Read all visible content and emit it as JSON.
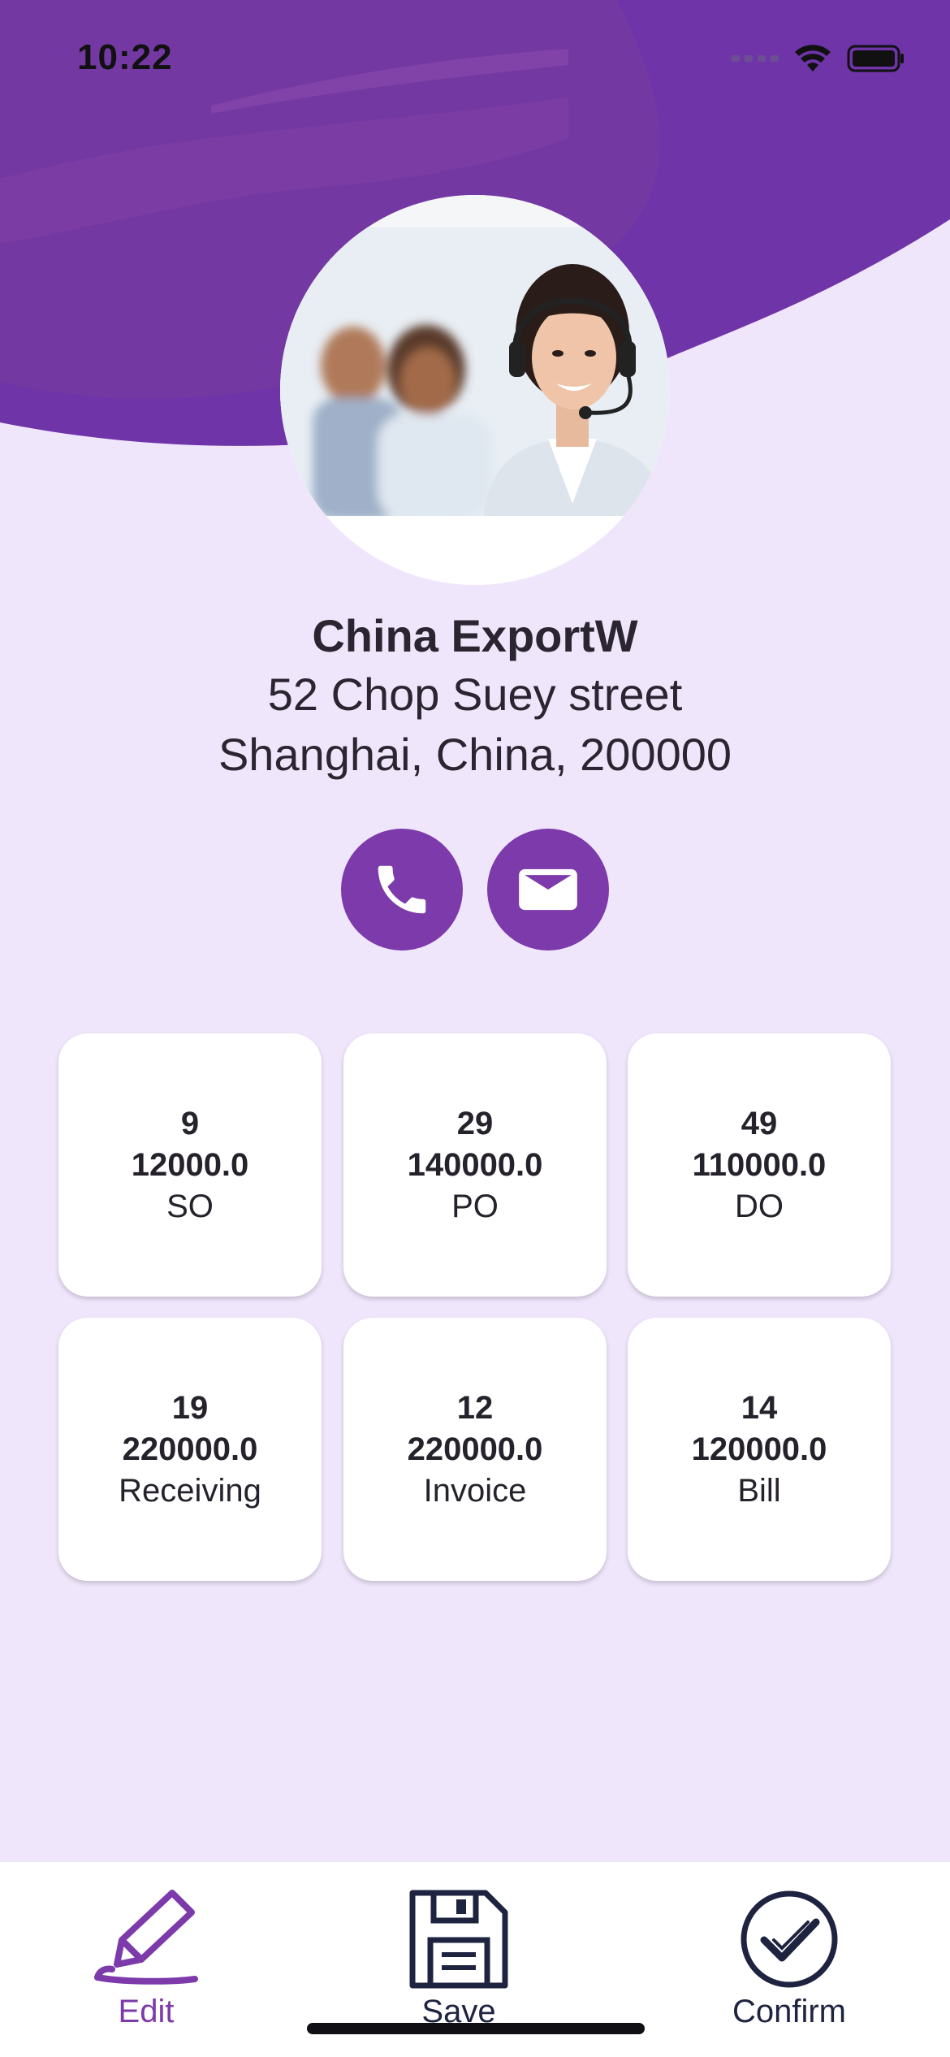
{
  "status_bar": {
    "time": "10:22"
  },
  "profile": {
    "name": "China ExportW",
    "address_line1": "52 Chop Suey street",
    "address_line2": "Shanghai, China, 200000"
  },
  "colors": {
    "accent": "#7C3AAA",
    "header": "#6E34A8",
    "background": "#F0E6FC",
    "card": "#FFFFFF"
  },
  "contact": {
    "phone_icon": "phone-icon",
    "mail_icon": "mail-icon"
  },
  "stats": [
    {
      "count": "9",
      "amount": "12000.0",
      "label": "SO"
    },
    {
      "count": "29",
      "amount": "140000.0",
      "label": "PO"
    },
    {
      "count": "49",
      "amount": "110000.0",
      "label": "DO"
    },
    {
      "count": "19",
      "amount": "220000.0",
      "label": "Receiving"
    },
    {
      "count": "12",
      "amount": "220000.0",
      "label": "Invoice"
    },
    {
      "count": "14",
      "amount": "120000.0",
      "label": "Bill"
    }
  ],
  "bottom_nav": {
    "edit": {
      "label": "Edit",
      "icon": "pencil-icon",
      "color": "#7C3AAA"
    },
    "save": {
      "label": "Save",
      "icon": "floppy-disk-icon",
      "color": "#1E2440"
    },
    "confirm": {
      "label": "Confirm",
      "icon": "check-circle-icon",
      "color": "#1E2440"
    }
  }
}
